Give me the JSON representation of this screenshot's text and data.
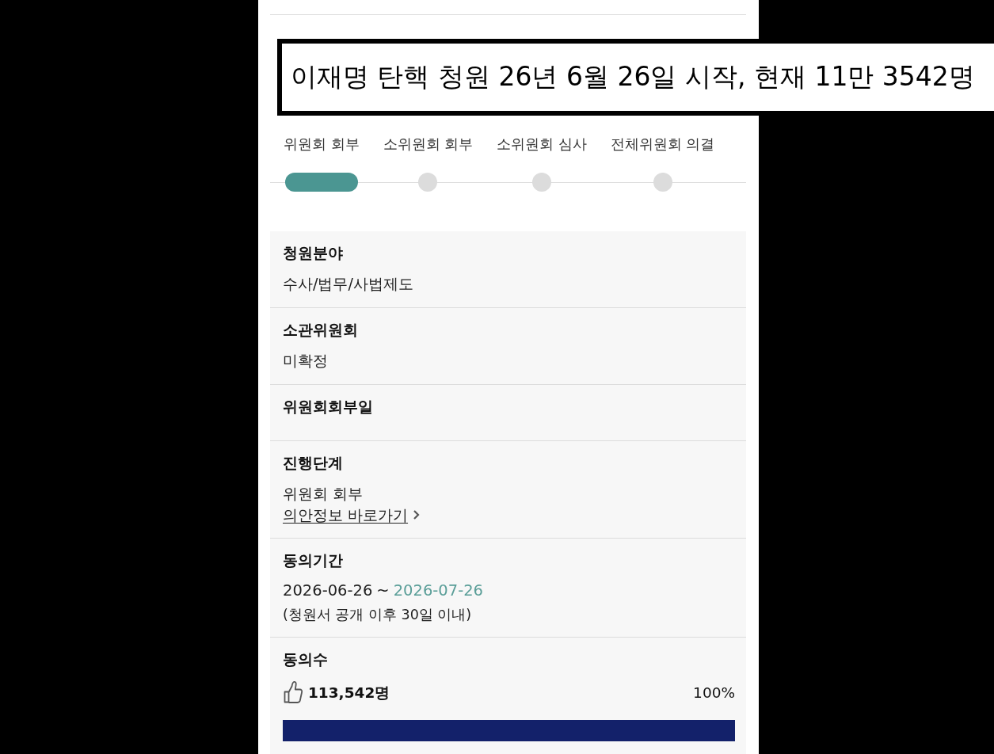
{
  "caption": {
    "text": "이재명 탄핵 청원 26년 6월 26일 시작, 현재 11만 3542명"
  },
  "steps": [
    {
      "label": "위원회 회부",
      "selected": true
    },
    {
      "label": "소위원회 회부",
      "selected": false
    },
    {
      "label": "소위원회 심사",
      "selected": false
    },
    {
      "label": "전체위원회 의결",
      "selected": false
    }
  ],
  "fields": [
    {
      "kind": "text",
      "label": "청원분야",
      "value": "수사/법무/사법제도"
    },
    {
      "kind": "text",
      "label": "소관위원회",
      "value": "미확정"
    },
    {
      "kind": "text",
      "label": "위원회회부일"
    },
    {
      "kind": "stage",
      "label": "진행단계",
      "value": "위원회 회부",
      "link": "의안정보 바로가기"
    },
    {
      "kind": "period",
      "label": "동의기간",
      "start": "2026-06-26",
      "separator": "~",
      "end": "2026-07-26",
      "note": "(청원서 공개 이후 30일 이내)"
    },
    {
      "kind": "count",
      "label": "동의수",
      "count": "113,542명",
      "percent": "100%",
      "level": 1
    }
  ]
}
